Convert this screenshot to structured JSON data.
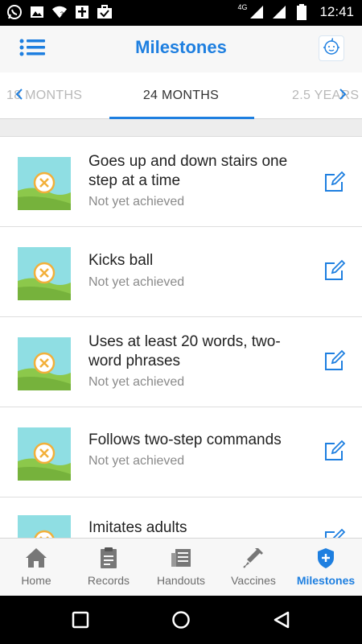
{
  "status_bar": {
    "time": "12:41",
    "network": "4G",
    "icons": [
      "whatsapp-icon",
      "image-icon",
      "wifi-question-icon",
      "cross-icon",
      "briefcase-check-icon",
      "signal-icon",
      "signal-icon",
      "battery-icon"
    ]
  },
  "app_bar": {
    "title": "Milestones",
    "menu_icon": "menu-list-icon",
    "profile_icon": "baby-face-icon"
  },
  "tabs": {
    "previous": "18 MONTHS",
    "current": "24 MONTHS",
    "next": "2.5 YEARS"
  },
  "milestones": [
    {
      "title": "Goes up and down stairs one step at a time",
      "status": "Not yet achieved"
    },
    {
      "title": "Kicks ball",
      "status": "Not yet achieved"
    },
    {
      "title": "Uses at least 20 words, two-word phrases",
      "status": "Not yet achieved"
    },
    {
      "title": "Follows two-step commands",
      "status": "Not yet achieved"
    },
    {
      "title": "Imitates adults",
      "status": ""
    }
  ],
  "bottom_nav": [
    {
      "label": "Home",
      "icon": "home-icon"
    },
    {
      "label": "Records",
      "icon": "clipboard-icon"
    },
    {
      "label": "Handouts",
      "icon": "newspaper-icon"
    },
    {
      "label": "Vaccines",
      "icon": "syringe-icon"
    },
    {
      "label": "Milestones",
      "icon": "shield-plus-icon",
      "active": true
    }
  ],
  "colors": {
    "accent": "#1e7fe0",
    "inactive": "#6d6d6d",
    "status_text": "#8a8a8a",
    "thumb_sky": "#8fdee3",
    "thumb_grass": "#8cc84b",
    "thumb_badge": "#f2b03a"
  }
}
